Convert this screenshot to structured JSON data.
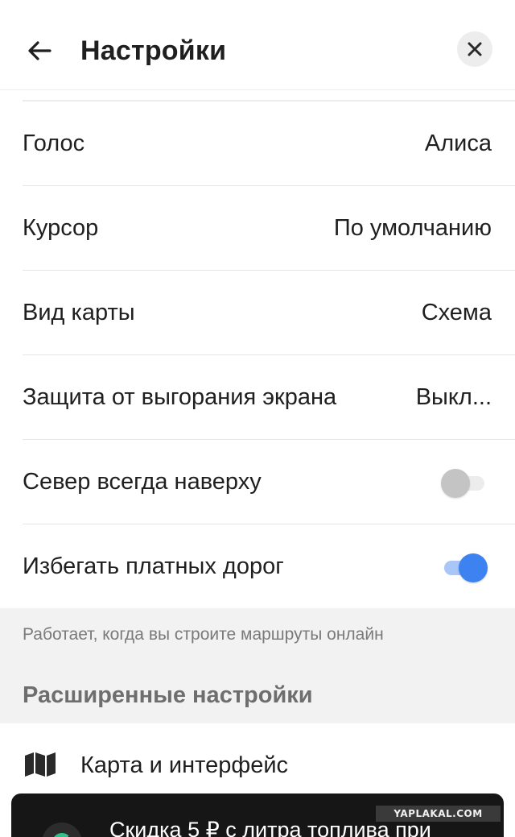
{
  "header": {
    "title": "Настройки",
    "back_icon": "arrow-left-icon",
    "close_icon": "close-icon"
  },
  "settings": [
    {
      "label": "Голос",
      "value": "Алиса"
    },
    {
      "label": "Курсор",
      "value": "По умолчанию"
    },
    {
      "label": "Вид карты",
      "value": "Схема"
    },
    {
      "label": "Защита от выгорания экрана",
      "value": "Выкл..."
    }
  ],
  "toggles": [
    {
      "label": "Север всегда наверху",
      "enabled": false
    },
    {
      "label": "Избегать платных дорог",
      "enabled": true
    }
  ],
  "hint": "Работает, когда вы строите маршруты онлайн",
  "advanced": {
    "section_title": "Расширенные настройки",
    "items": [
      {
        "label": "Карта и интерфейс",
        "icon": "map-icon"
      }
    ]
  },
  "ad": {
    "text": "Скидка 5 ₽ с литра топлива при"
  },
  "watermark": "YAPLAKAL.COM",
  "colors": {
    "accent": "#3c82f0",
    "toggle_off": "#c4c4c4",
    "section_bg": "#f2f2f2",
    "ad_bg": "#161616"
  }
}
